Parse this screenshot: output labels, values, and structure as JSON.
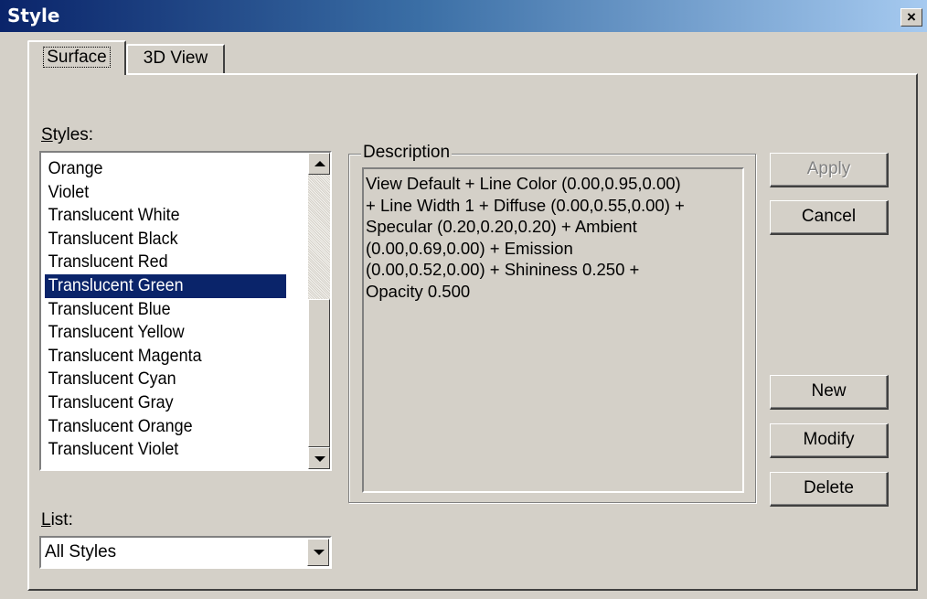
{
  "window": {
    "title": "Style",
    "close": "×"
  },
  "tabs": [
    {
      "label": "Surface"
    },
    {
      "label": "3D View"
    }
  ],
  "styles": {
    "label_prefix": "S",
    "label_rest": "tyles:",
    "items": [
      "Orange",
      "Violet",
      "Translucent White",
      "Translucent Black",
      "Translucent Red",
      "Translucent Green",
      "Translucent Blue",
      "Translucent Yellow",
      "Translucent Magenta",
      "Translucent Cyan",
      "Translucent Gray",
      "Translucent Orange",
      "Translucent Violet"
    ],
    "selected": "Translucent Green"
  },
  "description": {
    "legend": "Description",
    "lines": [
      "View Default + Line Color (0.00,0.95,0.00)",
      "+ Line Width 1 + Diffuse (0.00,0.55,0.00) +",
      "Specular (0.20,0.20,0.20) + Ambient",
      "(0.00,0.69,0.00) + Emission",
      "(0.00,0.52,0.00) + Shininess 0.250 +",
      "Opacity 0.500"
    ]
  },
  "buttons": {
    "apply": "Apply",
    "cancel": "Cancel",
    "new": "New",
    "modify": "Modify",
    "delete": "Delete"
  },
  "list": {
    "label_prefix": "L",
    "label_rest": "ist:",
    "value": "All Styles"
  }
}
